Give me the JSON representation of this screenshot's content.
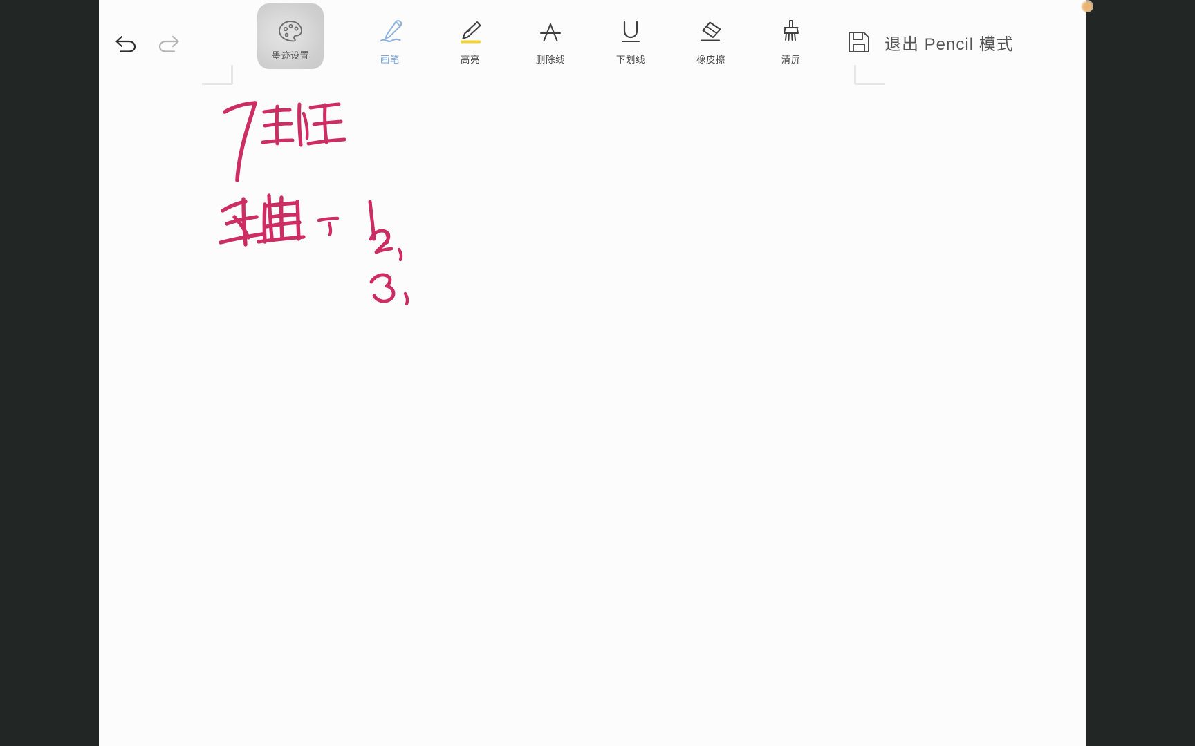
{
  "window": {
    "background_color": "#fcfcfc",
    "letterbox_color": "#222725"
  },
  "status_indicator": {
    "name": "recording-indicator-dot",
    "color": "#e8b06a"
  },
  "toolbar": {
    "history": [
      {
        "name": "undo-button",
        "icon": "undo-arrow-icon",
        "state": "enabled",
        "color": "#2e2e2e"
      },
      {
        "name": "redo-button",
        "icon": "redo-arrow-icon",
        "state": "disabled",
        "color": "#b3b3b3"
      }
    ],
    "ink_settings": {
      "label": "墨迹设置",
      "icon": "palette-icon",
      "selected": true,
      "chip_color": "#d4d4d4"
    },
    "tools": [
      {
        "label": "画笔",
        "icon": "pen-icon",
        "active": true,
        "accent": "#7ba4d9"
      },
      {
        "label": "高亮",
        "icon": "highlighter-icon",
        "active": false,
        "accent": "#f2d33c"
      },
      {
        "label": "删除线",
        "icon": "strikethrough-icon",
        "active": false,
        "accent": "#4a4a4a"
      },
      {
        "label": "下划线",
        "icon": "underline-icon",
        "active": false,
        "accent": "#4a4a4a"
      },
      {
        "label": "橡皮擦",
        "icon": "eraser-icon",
        "active": false,
        "accent": "#4a4a4a"
      },
      {
        "label": "清屏",
        "icon": "broom-icon",
        "active": false,
        "accent": "#4a4a4a"
      }
    ],
    "save": {
      "name": "save-button",
      "icon": "floppy-disk-icon"
    },
    "exit": {
      "label": "退出 Pencil 模式",
      "name": "exit-pencil-mode-button"
    }
  },
  "canvas": {
    "page_markers": [
      "corner-bracket-left",
      "corner-bracket-right"
    ],
    "ink_color": "#cc2d62",
    "notes": [
      {
        "text": "7班"
      },
      {
        "text": "轴上："
      },
      {
        "text": "1、"
      },
      {
        "text": "2、"
      },
      {
        "text": "3、"
      }
    ]
  }
}
